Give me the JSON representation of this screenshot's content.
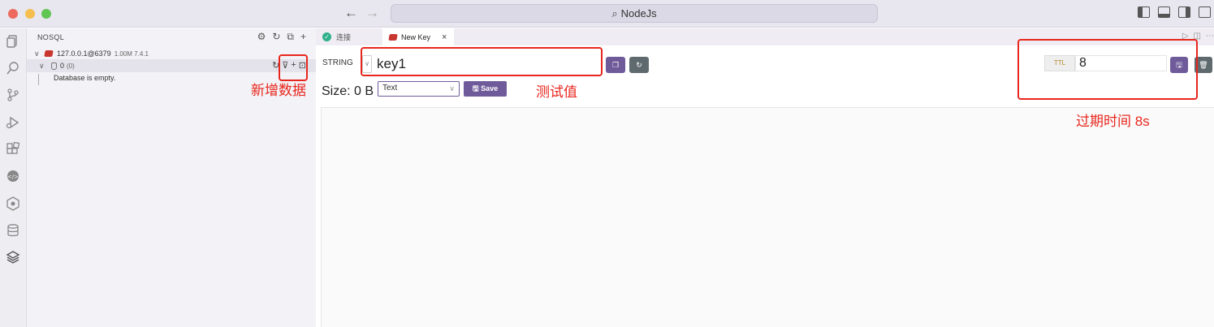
{
  "window": {
    "search_text": "NodeJs"
  },
  "sidebar": {
    "title": "NOSQL",
    "connection": {
      "host": "127.0.0.1@6379",
      "meta": "1.00M 7.4.1"
    },
    "database": {
      "name": "0",
      "count": "(0)",
      "empty_message": "Database is empty."
    }
  },
  "tabs": [
    {
      "label": "连接"
    },
    {
      "label": "New Key"
    }
  ],
  "editor": {
    "type": "STRING",
    "key_value": "key1",
    "size": "Size: 0 B",
    "format": "Text",
    "save_label": "Save",
    "ttl_label": "TTL",
    "ttl_value": "8"
  },
  "annotations": {
    "add_data": "新增数据",
    "test_value": "测试值",
    "expire_time": "过期时间  8s"
  },
  "colors": {
    "accent": "#6f5b9a",
    "annotation": "#e8261d",
    "redis": "#c8362f"
  }
}
